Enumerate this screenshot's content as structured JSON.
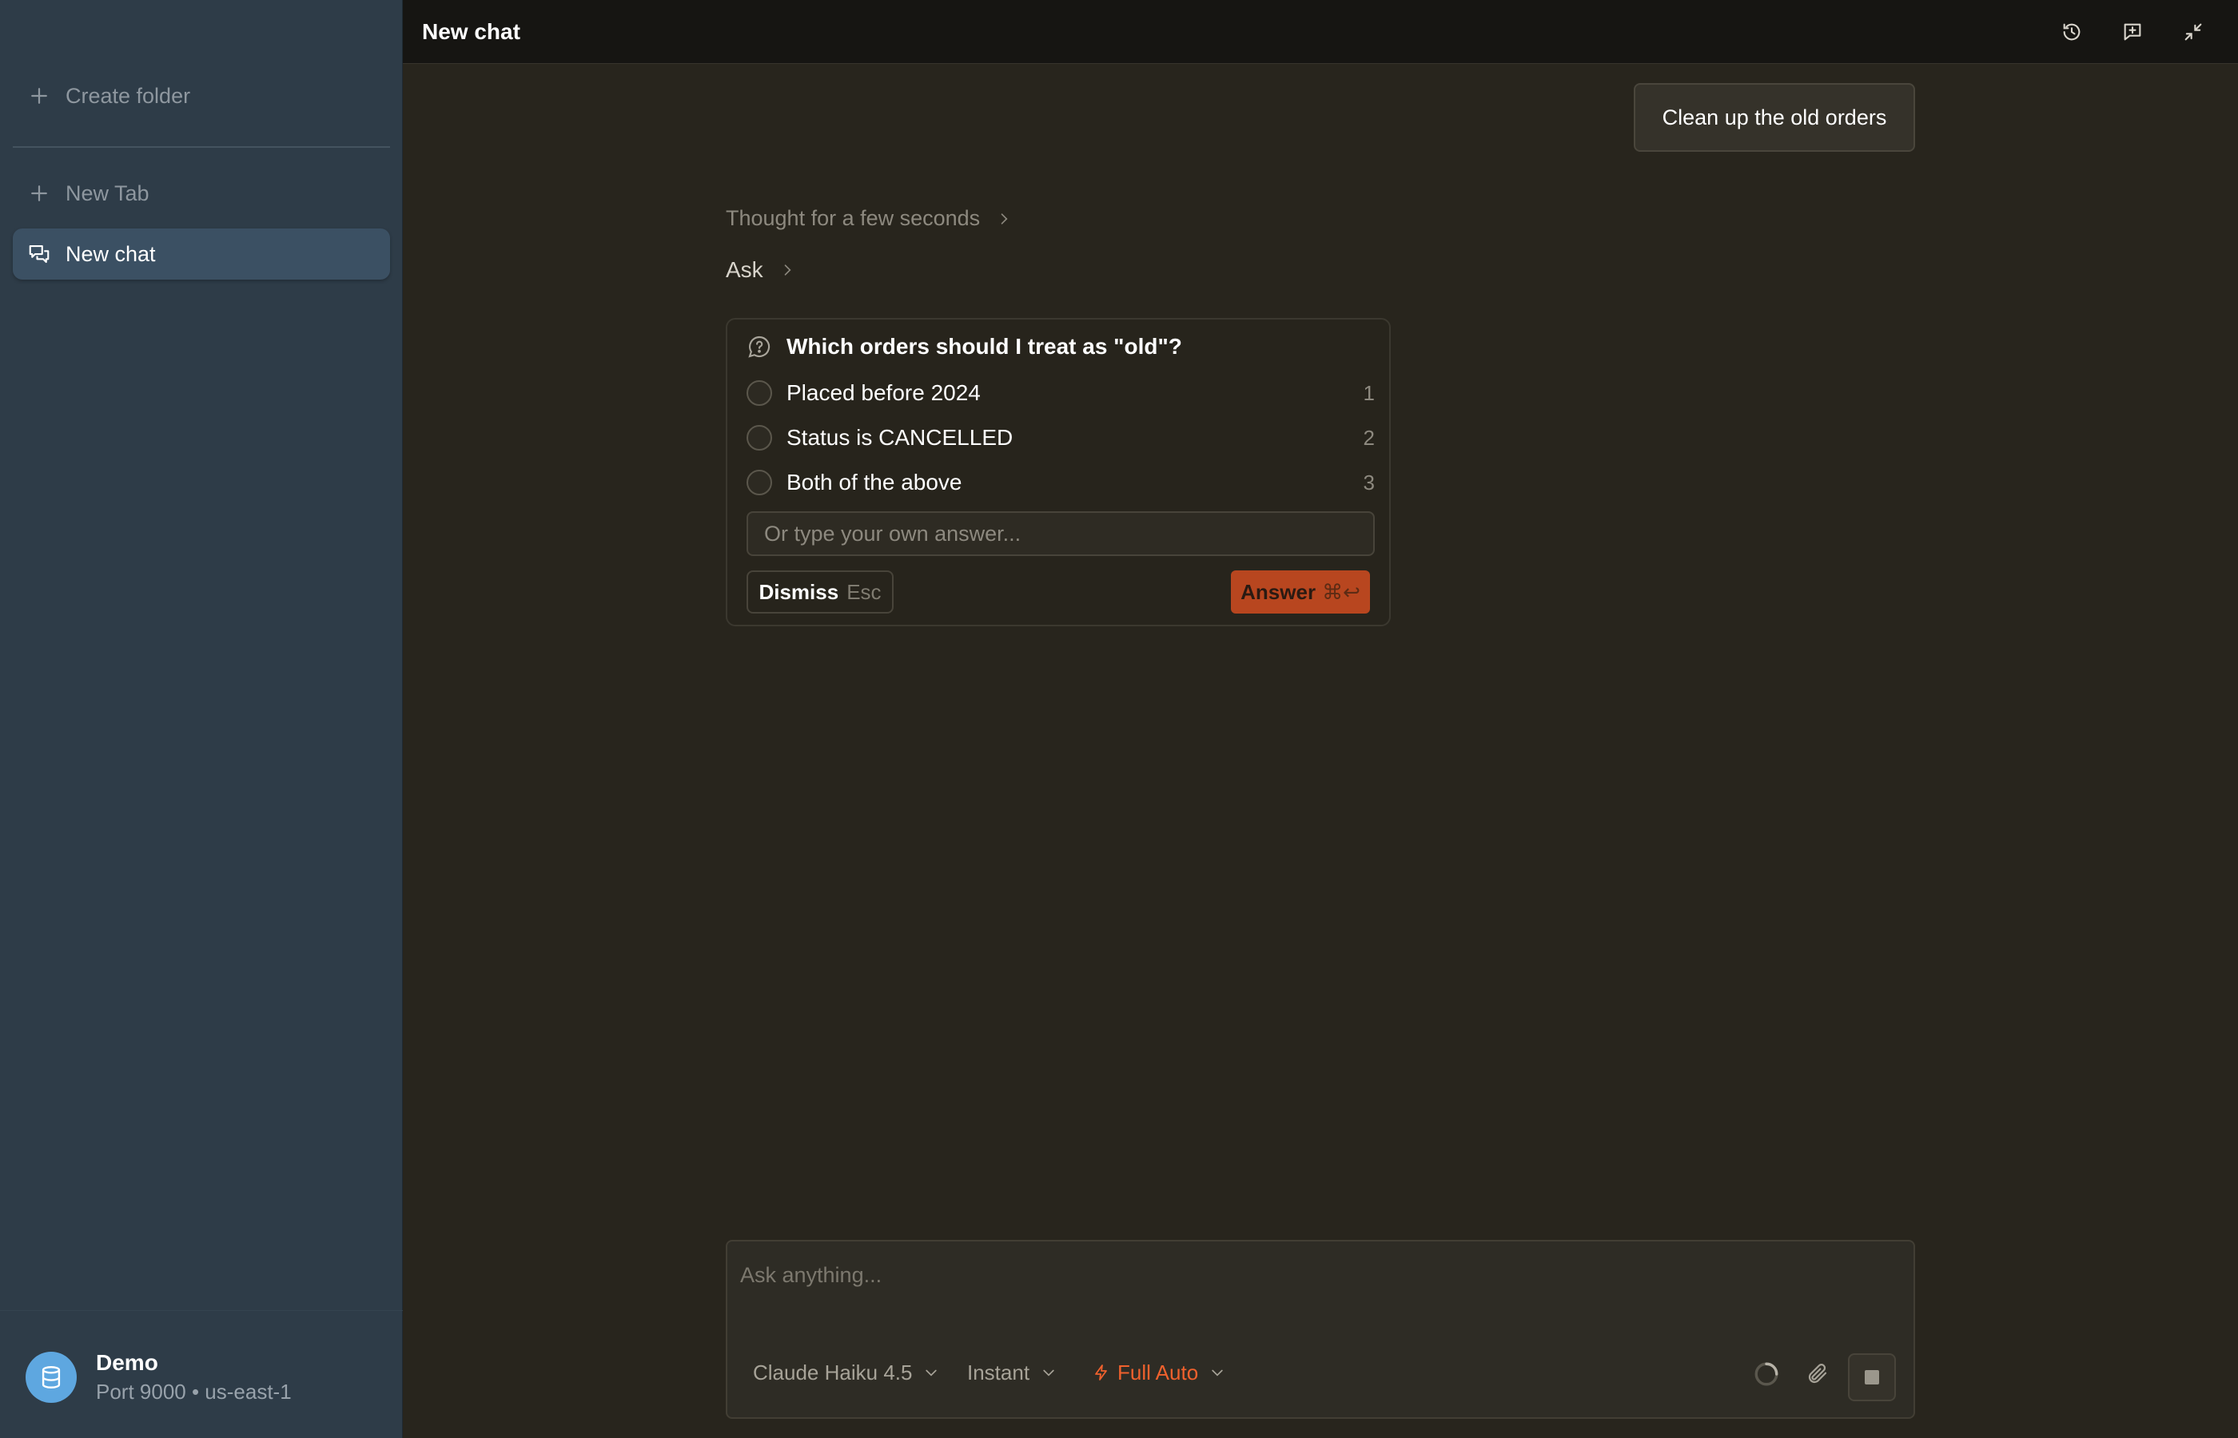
{
  "sidebar": {
    "create_folder_label": "Create folder",
    "new_tab_label": "New Tab",
    "chats": [
      {
        "label": "New chat",
        "active": true
      }
    ],
    "profile": {
      "name": "Demo",
      "detail": "Port 9000 • us-east-1",
      "avatar_icon": "database-icon",
      "avatar_color": "#5ea7e0"
    }
  },
  "header": {
    "title": "New chat",
    "actions": [
      "history-icon",
      "new-chat-icon",
      "collapse-icon"
    ]
  },
  "chat": {
    "user_message": "Clean up the old orders",
    "thought_label": "Thought for a few seconds",
    "tool_label": "Ask",
    "question": {
      "title": "Which orders should I treat as \"old\"?",
      "options": [
        {
          "label": "Placed before 2024",
          "key": "1"
        },
        {
          "label": "Status is CANCELLED",
          "key": "2"
        },
        {
          "label": "Both of the above",
          "key": "3"
        }
      ],
      "input_placeholder": "Or type your own answer...",
      "dismiss_label": "Dismiss",
      "dismiss_key": "Esc",
      "answer_label": "Answer",
      "answer_key": "⌘↩",
      "answer_color": "#b8461f"
    }
  },
  "composer": {
    "placeholder": "Ask anything...",
    "model_label": "Claude Haiku 4.5",
    "mode_label": "Instant",
    "autonomy_label": "Full Auto",
    "autonomy_color": "#f0612d"
  }
}
